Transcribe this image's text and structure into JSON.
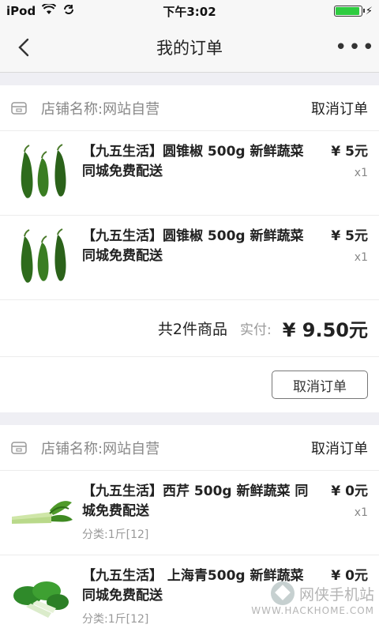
{
  "status_bar": {
    "carrier": "iPod",
    "time": "下午3:02",
    "battery_level": 0.95,
    "wifi_icon": "wifi-icon",
    "sync_icon": "sync-icon",
    "charge_icon": "⚡"
  },
  "nav": {
    "title": "我的订单",
    "back_icon": "chevron-left-icon",
    "more_label": "•••"
  },
  "orders": [
    {
      "shop_name": "店铺名称:网站自营",
      "action_label": "取消订单",
      "items": [
        {
          "name": "【九五生活】圆锥椒 500g 新鲜蔬菜 同城免费配送",
          "price": "¥ 5元",
          "qty": "x1",
          "image_icon": "green-pepper-icon"
        },
        {
          "name": "【九五生活】圆锥椒 500g 新鲜蔬菜 同城免费配送",
          "price": "¥ 5元",
          "qty": "x1",
          "image_icon": "green-pepper-icon"
        }
      ],
      "summary_count": "共2件商品",
      "summary_label": "实付:",
      "summary_total": "¥ 9.50元",
      "button_label": "取消订单"
    },
    {
      "shop_name": "店铺名称:网站自营",
      "action_label": "取消订单",
      "items": [
        {
          "name": "【九五生活】西芹 500g 新鲜蔬菜 同城免费配送",
          "price": "¥ 0元",
          "qty": "x1",
          "category": "分类:1斤[12]",
          "image_icon": "celery-icon"
        },
        {
          "name": "【九五生活】 上海青500g 新鲜蔬菜 同城免费配送",
          "price": "¥ 0元",
          "qty": "",
          "category": "分类:1斤[12]",
          "image_icon": "bok-choy-icon"
        }
      ]
    }
  ],
  "watermark": {
    "cn": "网侠手机站",
    "en": "WWW.HACKHOME.COM"
  },
  "colors": {
    "background": "#efeff4",
    "card": "#ffffff",
    "text": "#222222",
    "muted": "#888888",
    "battery": "#2ecc40"
  }
}
